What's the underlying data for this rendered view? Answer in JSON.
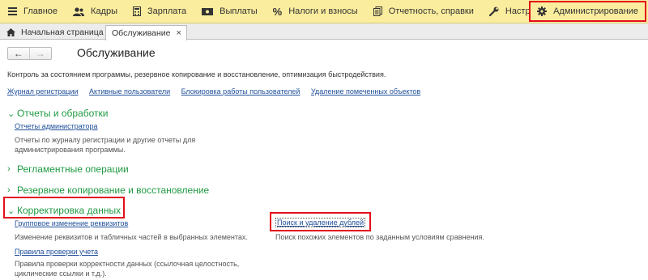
{
  "menu": {
    "items": [
      {
        "label": "Главное",
        "icon": "menu-lines-icon"
      },
      {
        "label": "Кадры",
        "icon": "people-icon"
      },
      {
        "label": "Зарплата",
        "icon": "calculator-icon"
      },
      {
        "label": "Выплаты",
        "icon": "cash-icon"
      },
      {
        "label": "Налоги и взносы",
        "icon": "percent-icon"
      },
      {
        "label": "Отчетность, справки",
        "icon": "documents-icon"
      },
      {
        "label": "Настройка",
        "icon": "wrench-icon"
      },
      {
        "label": "Администрирование",
        "icon": "gear-icon"
      }
    ],
    "active": "Администрирование"
  },
  "tabs": {
    "home": {
      "label": "Начальная страница",
      "icon": "home-icon"
    },
    "current": {
      "label": "Обслуживание",
      "close": "×"
    }
  },
  "nav": {
    "back": "←",
    "forward": "→"
  },
  "page": {
    "title": "Обслуживание",
    "description": "Контроль за состоянием программы, резервное копирование и восстановление, оптимизация быстродействия."
  },
  "top_links": [
    "Журнал регистрации",
    "Активные пользователи",
    "Блокировка работы пользователей",
    "Удаление помеченных объектов"
  ],
  "sections": {
    "reports": {
      "title": "Отчеты и обработки",
      "state": "expanded",
      "link": "Отчеты администратора",
      "note": "Отчеты по журналу регистрации и другие отчеты для администрирования программы."
    },
    "reglam": {
      "title": "Регламентные операции",
      "state": "collapsed"
    },
    "backup": {
      "title": "Резервное копирование и восстановление",
      "state": "collapsed"
    },
    "correction": {
      "title": "Корректировка данных",
      "state": "expanded",
      "group_link": "Групповое изменение реквизитов",
      "group_note": "Изменение реквизитов и табличных частей в выбранных элементах.",
      "rules_link": "Правила проверки учета",
      "rules_note": "Правила проверки корректности данных (ссылочная целостность, циклические ссылки и т.д.).",
      "dup_link": "Поиск и удаление дублей",
      "dup_note": "Поиск похожих элементов по заданным условиям сравнения."
    }
  },
  "colors": {
    "menu_bg": "#fbed9e",
    "section_green": "#209a43",
    "link_blue": "#1f4f9a",
    "highlight_red": "#e30f1a"
  }
}
